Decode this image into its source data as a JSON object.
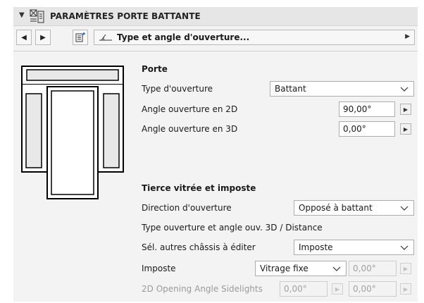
{
  "header": {
    "title": "PARAMÈTRES PORTE BATTANTE"
  },
  "toolbar": {
    "selector_label": "Type et angle d'ouverture..."
  },
  "porte": {
    "heading": "Porte",
    "type_label": "Type d'ouverture",
    "type_value": "Battant",
    "angle2d_label": "Angle ouverture en 2D",
    "angle2d_value": "90,00°",
    "angle3d_label": "Angle ouverture en 3D",
    "angle3d_value": "0,00°"
  },
  "tierce": {
    "heading": "Tierce vitrée et imposte",
    "direction_label": "Direction d'ouverture",
    "direction_value": "Opposé à battant",
    "type_distance_label": "Type ouverture et angle ouv. 3D / Distance",
    "sel_label": "Sél. autres châssis à éditer",
    "sel_value": "Imposte",
    "imposte_label": "Imposte",
    "imposte_value": "Vitrage fixe",
    "imposte_angle": "0,00°",
    "sidelights_label": "2D Opening Angle Sidelights",
    "sidelights_left": "0,00°",
    "sidelights_right": "0,00°"
  }
}
